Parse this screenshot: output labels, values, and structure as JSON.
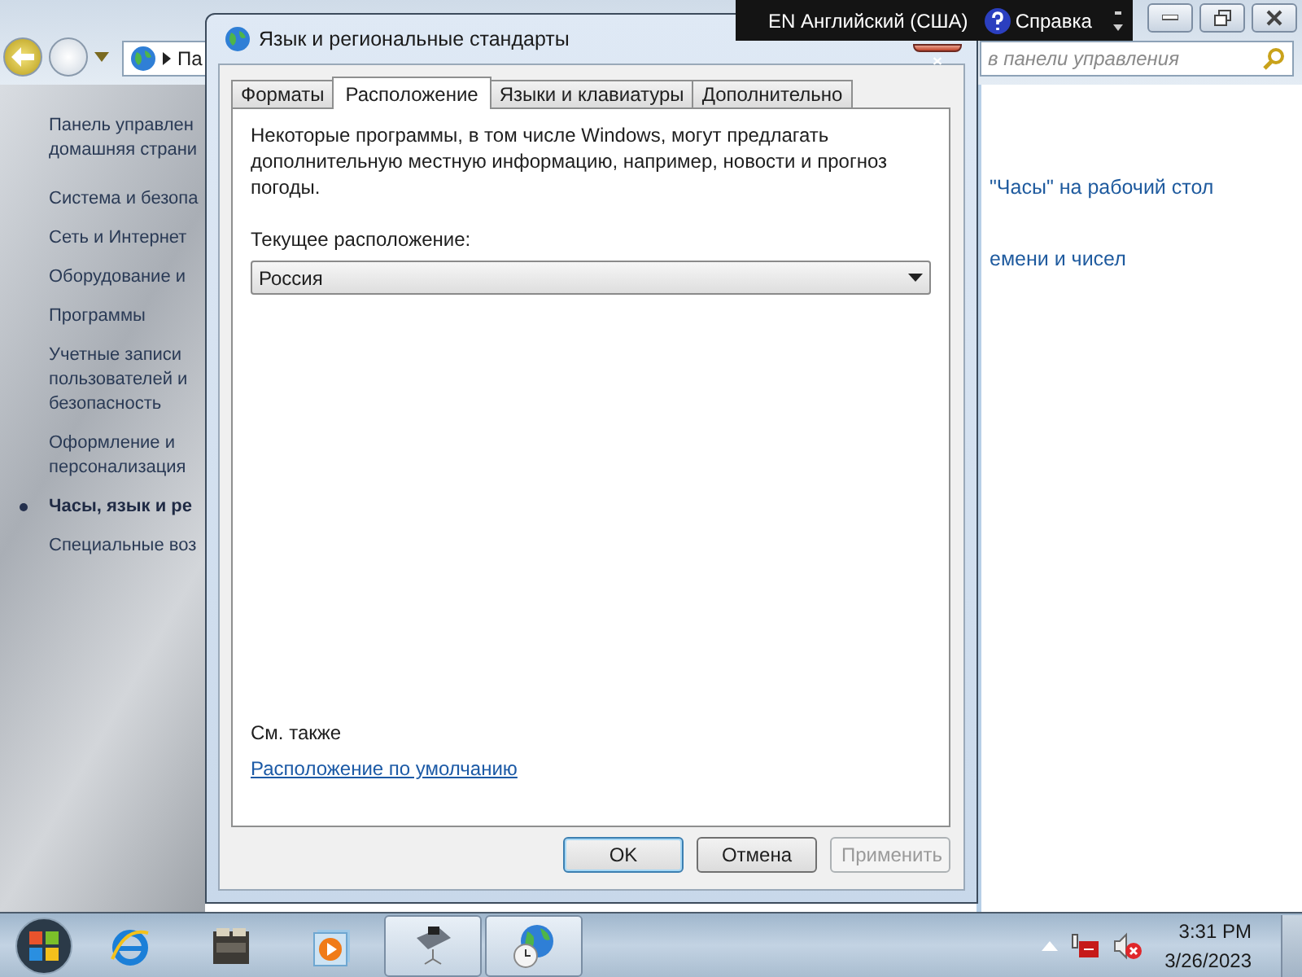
{
  "control_panel": {
    "address": "Па",
    "search_placeholder": "в панели управления",
    "sidebar": [
      {
        "label": "Панель управлен домашняя страни",
        "selected": false
      },
      {
        "label": "Система и безопа",
        "selected": false
      },
      {
        "label": "Сеть и Интернет",
        "selected": false
      },
      {
        "label": "Оборудование и",
        "selected": false
      },
      {
        "label": "Программы",
        "selected": false
      },
      {
        "label": "Учетные записи пользователей и безопасность",
        "selected": false
      },
      {
        "label": "Оформление и персонализация",
        "selected": false
      },
      {
        "label": "Часы, язык и ре",
        "selected": true
      },
      {
        "label": "Специальные воз",
        "selected": false
      }
    ],
    "links": [
      "\"Часы\" на рабочий стол",
      "емени и чисел"
    ]
  },
  "language_bar": {
    "language": "EN Английский (США)",
    "help": "Справка"
  },
  "dialog": {
    "title": "Язык и региональные стандарты",
    "tabs": [
      {
        "label": "Форматы",
        "selected": false
      },
      {
        "label": "Расположение",
        "selected": true
      },
      {
        "label": "Языки и клавиатуры",
        "selected": false
      },
      {
        "label": "Дополнительно",
        "selected": false
      }
    ],
    "description": "Некоторые программы, в том числе Windows, могут предлагать дополнительную местную информацию, например, новости и прогноз погоды.",
    "location_label": "Текущее расположение:",
    "location_value": "Россия",
    "see_also": "См. также",
    "link": "Расположение по умолчанию",
    "buttons": [
      {
        "label": "OK",
        "kind": "default",
        "disabled": false
      },
      {
        "label": "Отмена",
        "kind": "normal",
        "disabled": false
      },
      {
        "label": "Применить",
        "kind": "normal",
        "disabled": true
      }
    ]
  },
  "taskbar": {
    "apps": [
      {
        "kind": "browser",
        "active": false
      },
      {
        "kind": "folder",
        "active": false
      },
      {
        "kind": "media",
        "active": false
      },
      {
        "kind": "scanner",
        "active": true
      },
      {
        "kind": "globe",
        "active": true
      }
    ],
    "time": "3:31 PM",
    "date": "3/26/2023"
  }
}
